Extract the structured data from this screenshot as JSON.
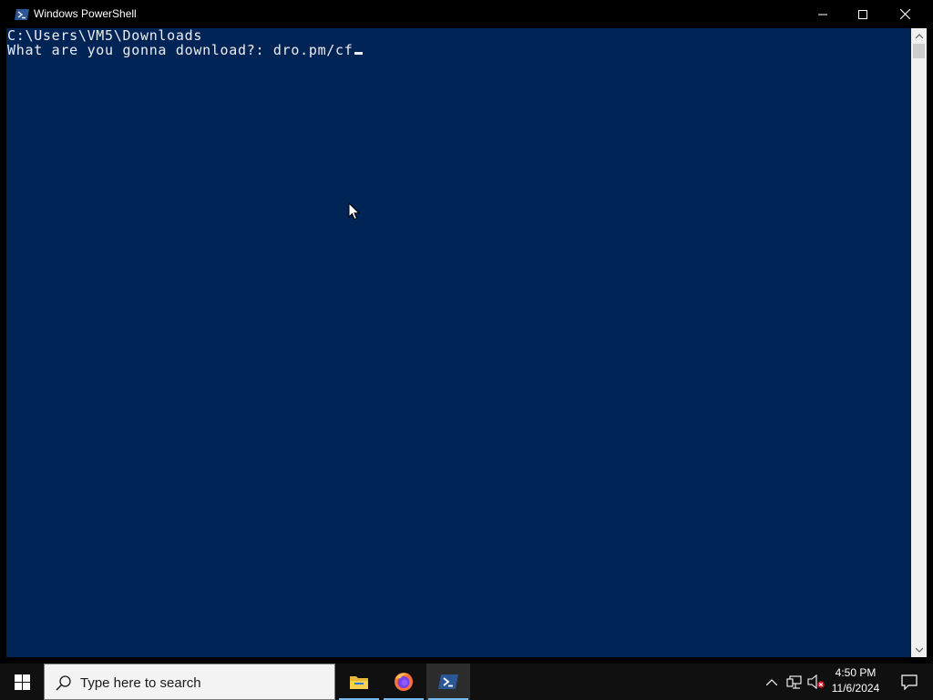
{
  "window": {
    "title": "Windows PowerShell",
    "controls": {
      "minimize": "minimize",
      "maximize": "maximize",
      "close": "close"
    }
  },
  "console": {
    "lines": [
      "C:\\Users\\VM5\\Downloads",
      "What are you gonna download?: dro.pm/cf"
    ],
    "background_color": "#012456",
    "text_color": "#eeedf0"
  },
  "taskbar": {
    "search_placeholder": "Type here to search",
    "apps": [
      "file-explorer-icon",
      "firefox-icon",
      "powershell-icon"
    ],
    "active_app": "powershell-icon",
    "tray_icons": [
      "chevron-up-icon",
      "network-icon",
      "volume-muted-icon"
    ],
    "time": "4:50 PM",
    "date": "11/6/2024"
  }
}
